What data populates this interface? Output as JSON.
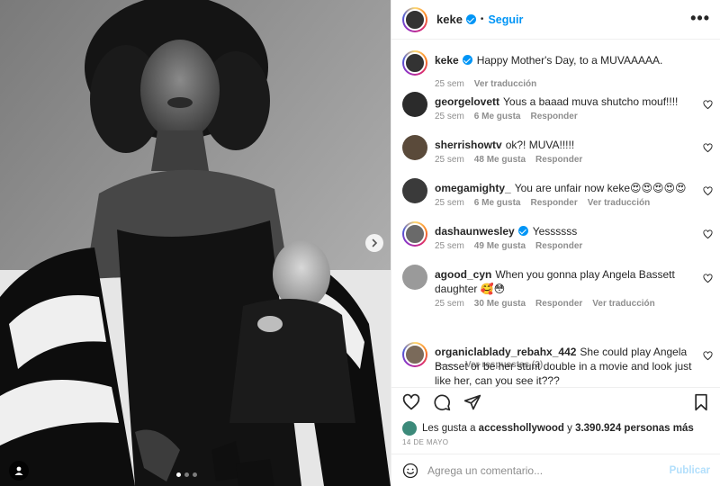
{
  "post": {
    "author": "keke",
    "follow_label": "Seguir",
    "separator": "•",
    "more_label": "•••"
  },
  "caption": {
    "user": "keke",
    "text": "Happy Mother's Day, to a MUVAAAAA.",
    "time": "25 sem",
    "translate": "Ver traducción"
  },
  "comments": [
    {
      "user": "georgelovett",
      "text": "Yous a baaad muva shutcho mouf!!!!",
      "time": "25 sem",
      "likes": "6 Me gusta",
      "reply": "Responder",
      "translate": ""
    },
    {
      "user": "sherrishowtv",
      "text": "ok?! MUVA!!!!!",
      "time": "25 sem",
      "likes": "48 Me gusta",
      "reply": "Responder",
      "translate": ""
    },
    {
      "user": "omegamighty_",
      "text": "You are unfair now keke😍😍😍😍😍",
      "time": "25 sem",
      "likes": "6 Me gusta",
      "reply": "Responder",
      "translate": "Ver traducción"
    },
    {
      "user": "dashaunwesley",
      "text": "Yessssss",
      "time": "25 sem",
      "likes": "49 Me gusta",
      "reply": "Responder",
      "translate": ""
    },
    {
      "user": "agood_cyn",
      "text": "When you gonna play Angela Bassett daughter 🥰😳",
      "time": "25 sem",
      "likes": "30 Me gusta",
      "reply": "Responder",
      "translate": "Ver traducción"
    },
    {
      "user": "organiclablady_rebahx_442",
      "text": "She could play Angela Basset or be her stunt double in a movie and look just like her, can you see it???",
      "time": "",
      "likes": "",
      "reply": "",
      "translate": ""
    }
  ],
  "view_replies": "Ver respuestas (2)",
  "likes_summary": {
    "prefix": "Les gusta a",
    "user": "accesshollywood",
    "middle": "y",
    "count": "3.390.924 personas más"
  },
  "date": "14 DE MAYO",
  "add_comment": {
    "placeholder": "Agrega un comentario...",
    "publish_label": "Publicar"
  },
  "icons": [
    "chevron-right-icon",
    "tag-user-icon",
    "heart-icon",
    "comment-icon",
    "share-icon",
    "bookmark-icon",
    "emoji-icon",
    "more-icon",
    "verified-badge-icon"
  ],
  "colors": {
    "accent": "#0095f6",
    "muted": "#8e8e8e",
    "text": "#262626",
    "publish_disabled": "#b2dffc"
  }
}
